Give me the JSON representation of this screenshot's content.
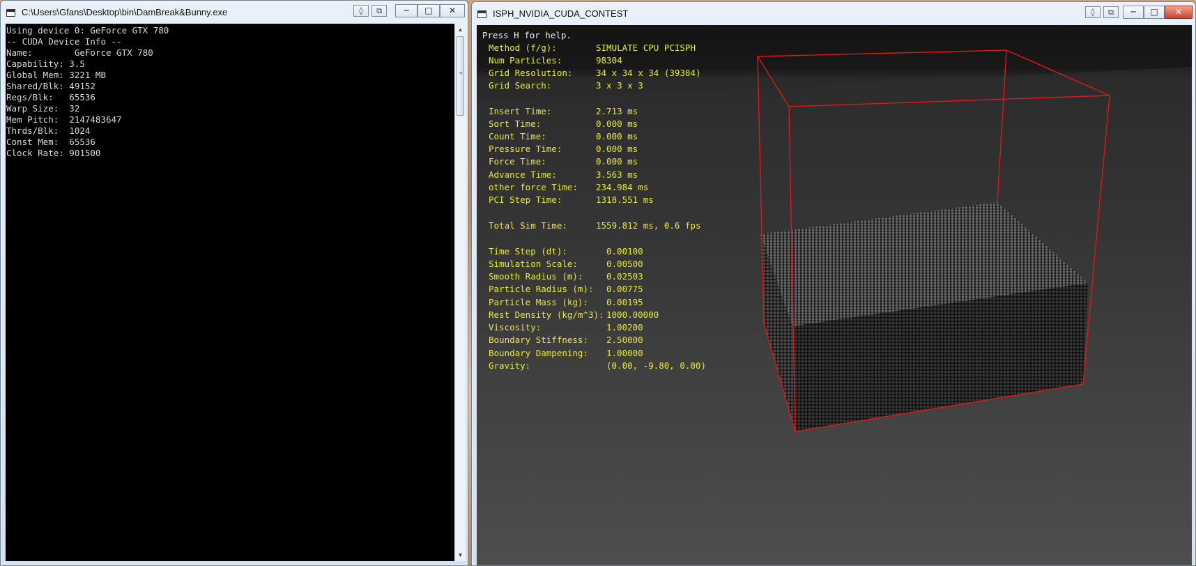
{
  "console_window": {
    "title": "C:\\Users\\Gfans\\Desktop\\bin\\DamBreak&Bunny.exe",
    "extra_buttons": [
      "◊",
      "⧉"
    ],
    "controls": [
      "─",
      "□",
      "✕"
    ],
    "lines": [
      "Using device 0: GeForce GTX 780",
      "-- CUDA Device Info --",
      "Name:        GeForce GTX 780",
      "Capability: 3.5",
      "Global Mem: 3221 MB",
      "Shared/Blk: 49152",
      "Regs/Blk:   65536",
      "Warp Size:  32",
      "Mem Pitch:  2147483647",
      "Thrds/Blk:  1024",
      "Const Mem:  65536",
      "Clock Rate: 901500"
    ],
    "scrollbar": {
      "up_arrow": "▲",
      "down_arrow": "▼",
      "grip": "≡"
    }
  },
  "gl_window": {
    "title": "ISPH_NVIDIA_CUDA_CONTEST",
    "extra_buttons": [
      "◊",
      "⧉"
    ],
    "controls": [
      "─",
      "□",
      "✕"
    ],
    "help": "Press H for help.",
    "stats_labels": [
      "Method (f/g):",
      "Num Particles:",
      "Grid Resolution:",
      "Grid Search:",
      "",
      "Insert Time:",
      "Sort Time:",
      "Count Time:",
      "Pressure Time:",
      "Force Time:",
      "Advance Time:",
      "other force Time:",
      "PCI Step Time:",
      "",
      "Total Sim Time:"
    ],
    "stats_values": [
      "SIMULATE CPU PCISPH",
      "98304",
      "34 x 34 x 34 (39304)",
      "3 x 3 x 3",
      "",
      "2.713 ms",
      "0.000 ms",
      "0.000 ms",
      "0.000 ms",
      "0.000 ms",
      "3.563 ms",
      "234.984 ms",
      "1318.551 ms",
      "",
      "1559.812 ms, 0.6 fps"
    ],
    "params_labels": [
      "Time Step (dt):",
      "Simulation Scale:",
      "Smooth Radius (m):",
      "Particle Radius (m):",
      "Particle Mass (kg):",
      "Rest Density (kg/m^3):",
      "Viscosity:",
      "Boundary Stiffness:",
      "Boundary Dampening:",
      "Gravity:"
    ],
    "params_values": [
      "0.00100",
      "0.00500",
      "0.02503",
      "0.00775",
      "0.00195",
      "1000.00000",
      "1.00200",
      "2.50000",
      "1.00000",
      "(0.00, -9.80, 0.00)"
    ],
    "colors": {
      "text": "#e8e83c",
      "box": "#e01818",
      "particles": "#2a2a2a"
    }
  }
}
